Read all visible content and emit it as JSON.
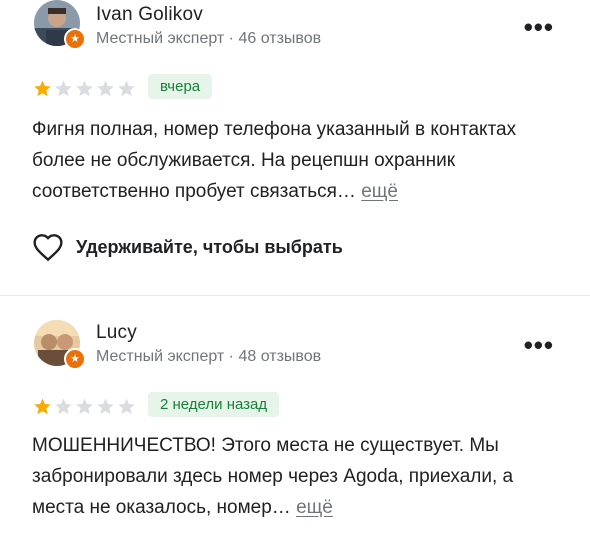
{
  "reviews": [
    {
      "author": "Ivan Golikov",
      "meta": "Местный эксперт · 46 отзывов",
      "rating": 1,
      "max_rating": 5,
      "date": "вчера",
      "text": "Фигня полная, номер телефона указанный в контактах более не обслуживается. На рецепшн охранник соответственно пробует связаться…",
      "more_label": "ещё",
      "like_label": "Удерживайте, чтобы выбрать"
    },
    {
      "author": "Lucy",
      "meta": "Местный эксперт · 48 отзывов",
      "rating": 1,
      "max_rating": 5,
      "date": "2 недели назад",
      "text": "МОШЕННИЧЕСТВО! Этого места не существует. Мы забронировали здесь номер через Agoda, приехали, а места не оказалось, номер…",
      "more_label": "ещё"
    }
  ],
  "icons": {
    "more_menu": "more-vert-icon",
    "local_guide_badge": "local-guide-star-icon",
    "like": "heart-outline-icon"
  },
  "colors": {
    "star_filled": "#f9ab00",
    "star_empty": "#dadce0",
    "chip_bg": "#e6f4ea",
    "chip_text": "#188038",
    "badge": "#e8710a"
  }
}
